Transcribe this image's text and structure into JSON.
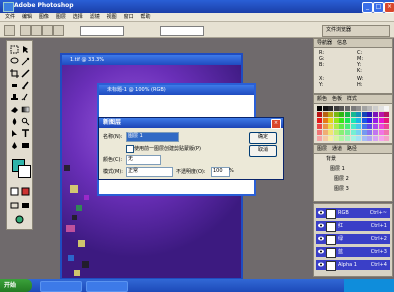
{
  "app": {
    "title": "Adobe Photoshop"
  },
  "menu": [
    "文件",
    "编辑",
    "图像",
    "图层",
    "选择",
    "滤镜",
    "视图",
    "窗口",
    "帮助"
  ],
  "options": {
    "selects": [
      "",
      ""
    ],
    "tab_label": "文件浏览器"
  },
  "doc_windows": {
    "back_title": "1.tif @ 33.3%",
    "front_title": "未标题-1 @ 100% (RGB)"
  },
  "dialog": {
    "title": "新图层",
    "name_label": "名称(N):",
    "name_value": "图层 1",
    "ok": "确定",
    "cancel": "取消",
    "checkbox_label": "使用前一图层创建剪贴蒙版(P)",
    "color_label": "颜色(C):",
    "color_value": "无",
    "mode_label": "模式(M):",
    "mode_value": "正常",
    "opacity_label": "不透明度(O):",
    "opacity_value": "100",
    "opacity_unit": "%"
  },
  "navigator": {
    "tabs": [
      "导航器",
      "信息"
    ],
    "readouts": [
      "R:",
      "G:",
      "B:",
      "C:",
      "M:",
      "Y:",
      "K:",
      "X:",
      "Y:",
      "W:",
      "H:"
    ]
  },
  "swatches": {
    "tabs": [
      "颜色",
      "色板",
      "样式"
    ]
  },
  "layers": {
    "tabs": [
      "图层",
      "通道",
      "路径"
    ],
    "rows": [
      "背景",
      "图层 1",
      "图层 2",
      "图层 3"
    ]
  },
  "channels": [
    {
      "name": "RGB",
      "shortcut": "Ctrl+~"
    },
    {
      "name": "红",
      "shortcut": "Ctrl+1"
    },
    {
      "name": "绿",
      "shortcut": "Ctrl+2"
    },
    {
      "name": "蓝",
      "shortcut": "Ctrl+3"
    },
    {
      "name": "Alpha 1",
      "shortcut": "Ctrl+4"
    }
  ],
  "taskbar": {
    "start": "开始",
    "clock": ""
  },
  "colors": {
    "accent": "#2a5fd6",
    "foreground_swatch": "#2fb4aa",
    "channel_row": "#3a3fc7"
  }
}
